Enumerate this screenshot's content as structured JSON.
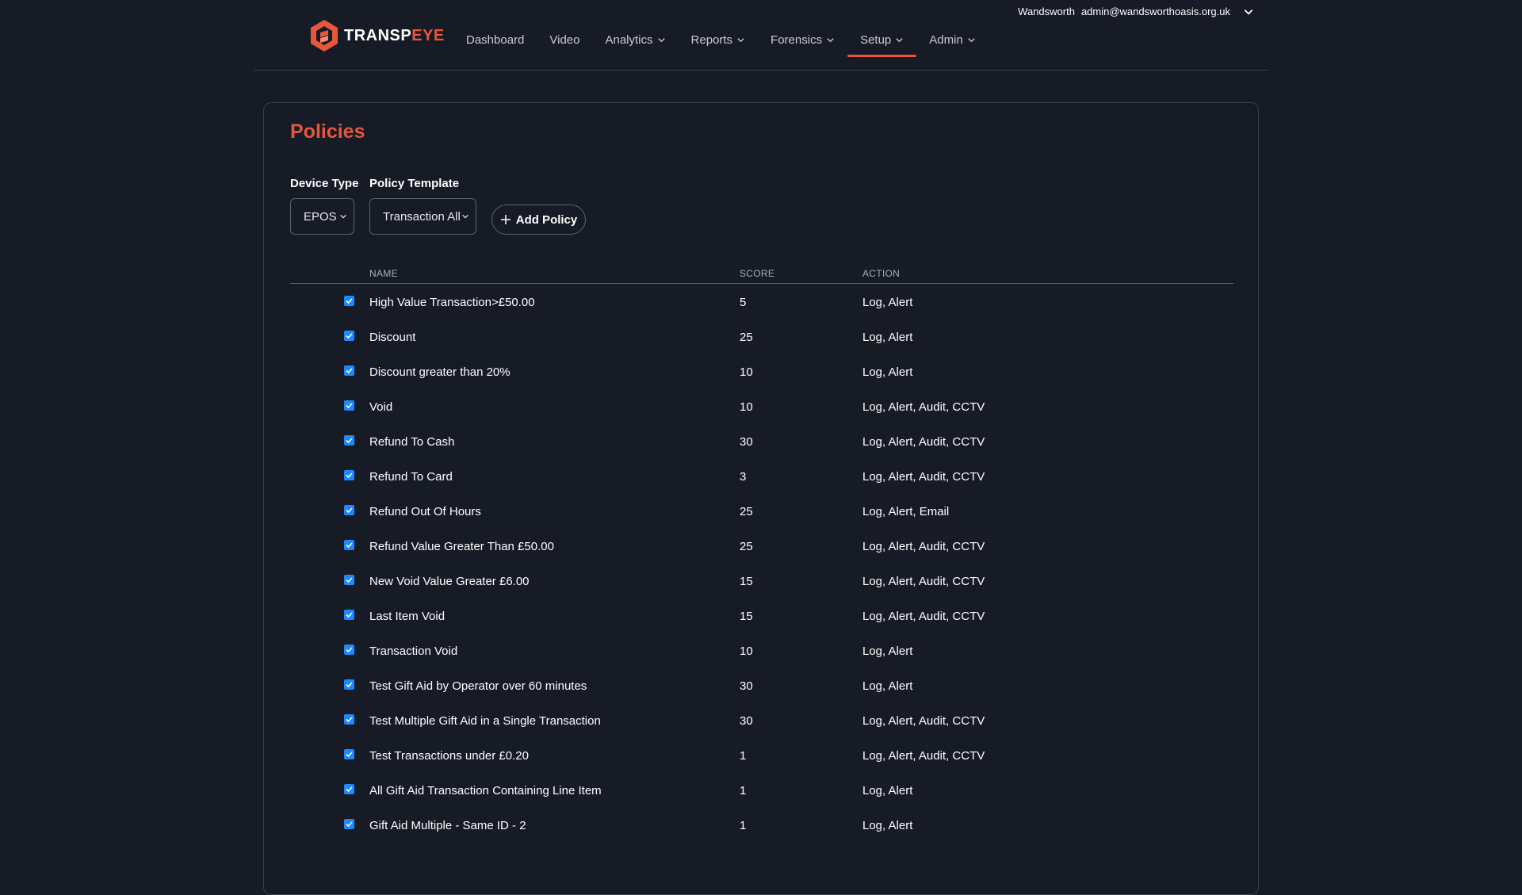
{
  "header": {
    "logo_primary": "TRANSP",
    "logo_accent": "EYE",
    "site": "Wandsworth",
    "email": "admin@wandsworthoasis.org.uk",
    "brand_color": "#e8573a",
    "nav": [
      {
        "label": "Dashboard",
        "has_menu": false
      },
      {
        "label": "Video",
        "has_menu": false
      },
      {
        "label": "Analytics",
        "has_menu": true
      },
      {
        "label": "Reports",
        "has_menu": true
      },
      {
        "label": "Forensics",
        "has_menu": true
      },
      {
        "label": "Setup",
        "has_menu": true,
        "active": true
      },
      {
        "label": "Admin",
        "has_menu": true
      }
    ]
  },
  "page": {
    "title": "Policies",
    "device_type_label": "Device Type",
    "device_type_value": "EPOS",
    "policy_template_label": "Policy Template",
    "policy_template_value": "Transaction All",
    "add_policy_label": "Add Policy"
  },
  "table": {
    "headers": {
      "name": "NAME",
      "score": "SCORE",
      "action": "ACTION"
    },
    "checkbox_color": "#1e88ff",
    "rows": [
      {
        "checked": true,
        "name": "High Value Transaction>£50.00",
        "score": "5",
        "action": "Log, Alert"
      },
      {
        "checked": true,
        "name": "Discount",
        "score": "25",
        "action": "Log, Alert"
      },
      {
        "checked": true,
        "name": "Discount greater than 20%",
        "score": "10",
        "action": "Log, Alert"
      },
      {
        "checked": true,
        "name": "Void",
        "score": "10",
        "action": "Log, Alert, Audit, CCTV"
      },
      {
        "checked": true,
        "name": "Refund To Cash",
        "score": "30",
        "action": "Log, Alert, Audit, CCTV"
      },
      {
        "checked": true,
        "name": "Refund To Card",
        "score": "3",
        "action": "Log, Alert, Audit, CCTV"
      },
      {
        "checked": true,
        "name": "Refund Out Of Hours",
        "score": "25",
        "action": "Log, Alert, Email"
      },
      {
        "checked": true,
        "name": "Refund Value Greater Than £50.00",
        "score": "25",
        "action": "Log, Alert, Audit, CCTV"
      },
      {
        "checked": true,
        "name": "New Void Value Greater £6.00",
        "score": "15",
        "action": "Log, Alert, Audit, CCTV"
      },
      {
        "checked": true,
        "name": "Last Item Void",
        "score": "15",
        "action": "Log, Alert, Audit, CCTV"
      },
      {
        "checked": true,
        "name": "Transaction Void",
        "score": "10",
        "action": "Log, Alert"
      },
      {
        "checked": true,
        "name": "Test Gift Aid by Operator over 60 minutes",
        "score": "30",
        "action": "Log, Alert"
      },
      {
        "checked": true,
        "name": "Test Multiple Gift Aid in a Single Transaction",
        "score": "30",
        "action": "Log, Alert, Audit, CCTV"
      },
      {
        "checked": true,
        "name": "Test Transactions under £0.20",
        "score": "1",
        "action": "Log, Alert, Audit, CCTV"
      },
      {
        "checked": true,
        "name": "All Gift Aid Transaction Containing Line Item",
        "score": "1",
        "action": "Log, Alert"
      },
      {
        "checked": true,
        "name": "Gift Aid Multiple - Same ID - 2",
        "score": "1",
        "action": "Log, Alert"
      }
    ]
  }
}
